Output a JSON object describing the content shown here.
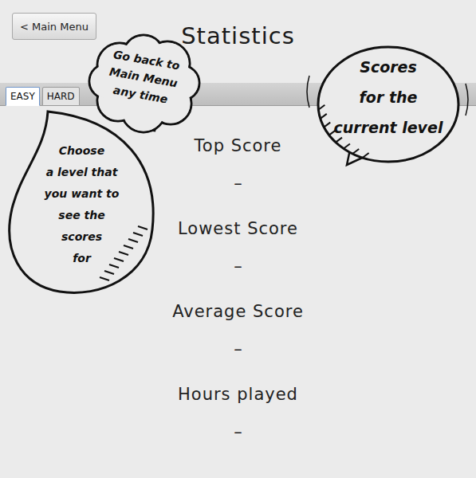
{
  "header": {
    "back_button": "< Main Menu",
    "title": "Statistics"
  },
  "tabs": [
    {
      "label": "EASY",
      "selected": true
    },
    {
      "label": "HARD",
      "selected": false
    }
  ],
  "stats": [
    {
      "label": "Top Score",
      "value": "–"
    },
    {
      "label": "Lowest Score",
      "value": "–"
    },
    {
      "label": "Average Score",
      "value": "–"
    },
    {
      "label": "Hours played",
      "value": "–"
    }
  ],
  "annotations": [
    {
      "lines": [
        "Go back to",
        "Main Menu",
        "any time"
      ]
    },
    {
      "lines": [
        "Scores",
        "for the",
        "current level"
      ]
    },
    {
      "lines": [
        "Choose",
        "a level that",
        "you want to",
        "see the",
        "scores",
        "for"
      ]
    }
  ]
}
